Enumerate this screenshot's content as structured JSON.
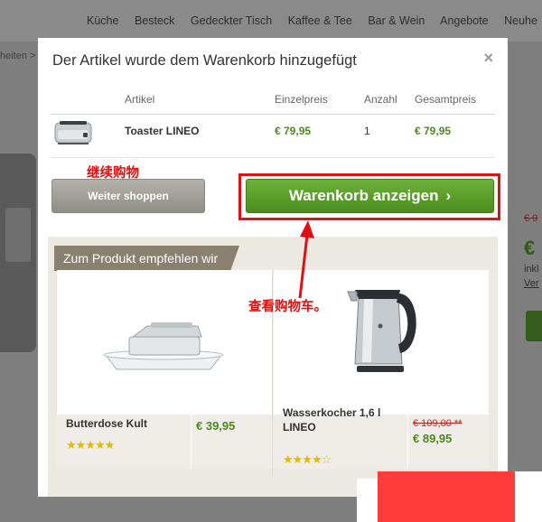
{
  "background": {
    "nav": [
      "Küche",
      "Besteck",
      "Gedeckter Tisch",
      "Kaffee & Tee",
      "Bar & Wein",
      "Angebote",
      "Neuhe"
    ],
    "breadcrumb": "heiten >",
    "old_price": "€ 9",
    "price": "€",
    "inkl": "inkl",
    "ver": "Ver"
  },
  "modal": {
    "title": "Der Artikel wurde dem Warenkorb hinzugefügt",
    "close": "×",
    "columns": {
      "article": "Artikel",
      "unit_price": "Einzelpreis",
      "qty": "Anzahl",
      "total": "Gesamtpreis"
    },
    "item": {
      "name": "Toaster LINEO",
      "unit_price": "€ 79,95",
      "qty": "1",
      "total": "€ 79,95"
    },
    "continue_label": "Weiter shoppen",
    "cart_label": "Warenkorb anzeigen",
    "cart_chevron": "›"
  },
  "annotations": {
    "continue_cn": "继续购物",
    "cart_cn": "查看购物车。",
    "color": "#e10f0f"
  },
  "reco": {
    "title": "Zum Produkt empfehlen wir",
    "products": [
      {
        "name": "Butterdose Kult",
        "price": "€ 39,95",
        "stars": "★★★★★",
        "rating": 5
      },
      {
        "name": "Wasserkocher 1,6 l LINEO",
        "old_price": "€ 109,00 **",
        "price": "€ 89,95",
        "stars": "★★★★☆",
        "rating": 4.5
      }
    ]
  },
  "colors": {
    "accent_green": "#4b8a1e",
    "button_green": "#5ea02c",
    "tab_brown": "#8a8070"
  }
}
